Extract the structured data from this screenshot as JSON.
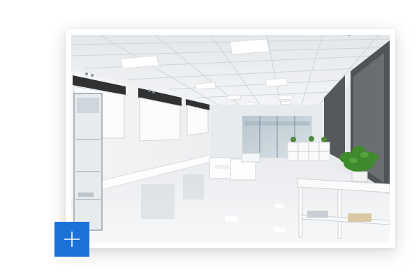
{
  "photo": {
    "subject": "showroom-interior"
  },
  "expand_button": {
    "icon": "plus-icon",
    "color": "#1d72d8"
  }
}
